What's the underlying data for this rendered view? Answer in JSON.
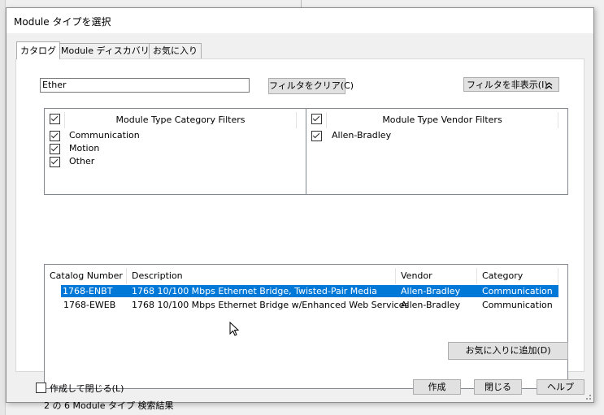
{
  "window": {
    "title": "Module タイプを選択"
  },
  "tabs": [
    {
      "label": "カタログ"
    },
    {
      "label": "Module ディスカバリー"
    },
    {
      "label": "お気に入り"
    }
  ],
  "search": {
    "value": "Ether"
  },
  "buttons": {
    "clear_filter": "フィルタをクリア(C)",
    "hide_filter": "フィルタを非表示(I)",
    "add_favorite": "お気に入りに追加(D)",
    "create": "作成",
    "close": "閉じる",
    "help": "ヘルプ"
  },
  "category_filters": {
    "header": "Module Type Category Filters",
    "header_checked": true,
    "items": [
      {
        "label": "Communication",
        "checked": true
      },
      {
        "label": "Motion",
        "checked": true
      },
      {
        "label": "Other",
        "checked": true
      }
    ]
  },
  "vendor_filters": {
    "header": "Module Type Vendor Filters",
    "header_checked": true,
    "items": [
      {
        "label": "Allen-Bradley",
        "checked": true
      }
    ]
  },
  "results": {
    "columns": [
      "Catalog Number",
      "Description",
      "Vendor",
      "Category"
    ],
    "rows": [
      {
        "catalog": "1768-ENBT",
        "description": "1768 10/100 Mbps Ethernet Bridge, Twisted-Pair Media",
        "vendor": "Allen-Bradley",
        "category": "Communication",
        "selected": true
      },
      {
        "catalog": "1768-EWEB",
        "description": "1768 10/100 Mbps Ethernet Bridge w/Enhanced Web Services",
        "vendor": "Allen-Bradley",
        "category": "Communication",
        "selected": false
      }
    ]
  },
  "status": {
    "text": "2 の 6 Module タイプ 検索結果"
  },
  "footer": {
    "create_and_close": "作成して閉じる(L)",
    "create_and_close_checked": false
  },
  "colors": {
    "selection": "#0078d7",
    "dialog_bg": "#f0f0f0"
  }
}
